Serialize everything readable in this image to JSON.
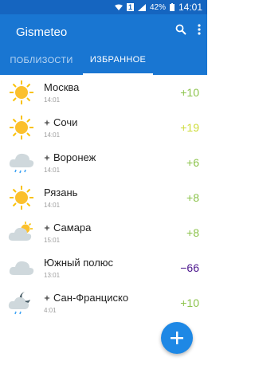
{
  "status_bar": {
    "battery": "42%",
    "time": "14:01",
    "sim": "1"
  },
  "app": {
    "title": "Gismeteo"
  },
  "tabs": [
    {
      "label": "ПОБЛИЗОСТИ"
    },
    {
      "label": "ИЗБРАННОЕ",
      "active": true
    }
  ],
  "cities": [
    {
      "name": "Москва",
      "time": "14:01",
      "temp": "+10",
      "icon": "sun-icon",
      "tracked": false,
      "temp_color": "#8bc34a"
    },
    {
      "name": "Сочи",
      "time": "14:01",
      "temp": "+19",
      "icon": "sun-icon",
      "tracked": true,
      "temp_color": "#cddc39"
    },
    {
      "name": "Воронеж",
      "time": "14:01",
      "temp": "+6",
      "icon": "rain-cloud-icon",
      "tracked": true,
      "temp_color": "#8bc34a"
    },
    {
      "name": "Рязань",
      "time": "14:01",
      "temp": "+8",
      "icon": "sun-icon",
      "tracked": false,
      "temp_color": "#8bc34a"
    },
    {
      "name": "Самара",
      "time": "15:01",
      "temp": "+8",
      "icon": "sun-cloud-icon",
      "tracked": true,
      "temp_color": "#8bc34a"
    },
    {
      "name": "Южный полюс",
      "time": "13:01",
      "temp": "−66",
      "icon": "cloud-icon",
      "tracked": false,
      "temp_color": "#4a148c"
    },
    {
      "name": "Сан-Франциско",
      "time": "4:01",
      "temp": "+10",
      "icon": "moon-rain-cloud-icon",
      "tracked": true,
      "temp_color": "#8bc34a"
    }
  ],
  "colors": {
    "appbar": "#1976d2",
    "statusbar": "#1565c0",
    "fab": "#1e88e5"
  }
}
